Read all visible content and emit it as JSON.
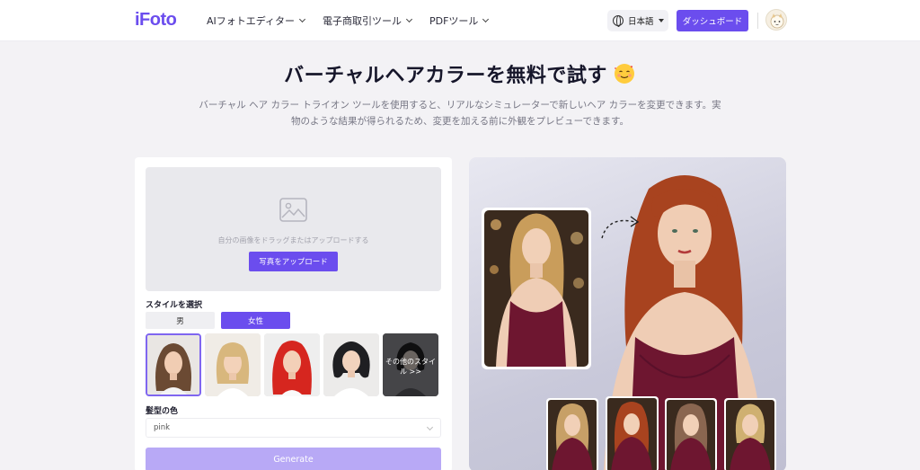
{
  "header": {
    "logo": "iFoto",
    "nav": [
      {
        "label": "AIフォトエディター"
      },
      {
        "label": "電子商取引ツール"
      },
      {
        "label": "PDFツール"
      }
    ],
    "language": "日本語",
    "dashboard_label": "ダッシュボード"
  },
  "hero": {
    "title": "バーチャルヘアカラーを無料で試す",
    "emoji": "🥰",
    "subtitle_line1": "バーチャル ヘア カラー トライオン ツールを使用すると、リアルなシミュレーターで新しいヘア カラーを変更できます。実",
    "subtitle_line2": "物のような結果が得られるため、変更を加える前に外観をプレビューできます。"
  },
  "editor": {
    "drop_text": "自分の画像をドラッグまたはアップロードする",
    "upload_label": "写真をアップロード",
    "style_label": "スタイルを選択",
    "gender_male": "男",
    "gender_female": "女性",
    "styles": [
      {
        "hair": "#6b4a33",
        "selected": true
      },
      {
        "hair": "#d8b77d",
        "selected": false
      },
      {
        "hair": "#d6261f",
        "selected": false
      },
      {
        "hair": "#1f1f22",
        "selected": false
      }
    ],
    "more_styles_line1": "その他のスタイ",
    "more_styles_line2": "ル >>",
    "color_label": "髪型の色",
    "color_value": "pink",
    "generate_label": "Generate"
  },
  "preview": {
    "main_hair": "#a8431f",
    "source_hair": "#c99d5b",
    "dress": "#6e1630",
    "variants": [
      {
        "hair": "#c7a067"
      },
      {
        "hair": "#a8431f"
      },
      {
        "hair": "#8a6650"
      },
      {
        "hair": "#cfb071"
      }
    ]
  }
}
